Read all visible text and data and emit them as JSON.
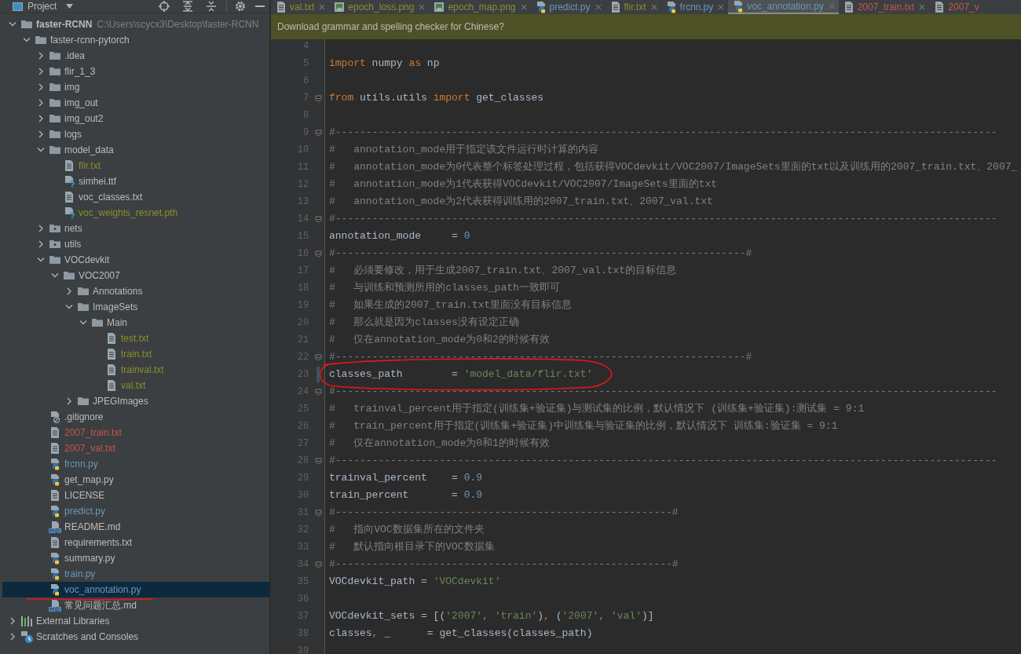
{
  "project_panel": {
    "title": "Project"
  },
  "tree": [
    {
      "name": "faster-RCNN",
      "kind": "folder",
      "path": "C:\\Users\\scycx3\\Desktop\\faster-RCNN",
      "color": "#bbbbbb",
      "expanded": true,
      "selected": false,
      "children": [
        {
          "name": "faster-rcnn-pytorch",
          "kind": "folder",
          "color": "#bbbbbb",
          "expanded": true,
          "selected": false,
          "children": [
            {
              "name": ".idea",
              "kind": "folder",
              "color": "#bbbbbb",
              "expanded": false,
              "selected": false
            },
            {
              "name": "flir_1_3",
              "kind": "folder",
              "color": "#bbbbbb",
              "expanded": false,
              "selected": false
            },
            {
              "name": "img",
              "kind": "folder",
              "color": "#bbbbbb",
              "expanded": false,
              "selected": false
            },
            {
              "name": "img_out",
              "kind": "folder",
              "color": "#bbbbbb",
              "expanded": false,
              "selected": false
            },
            {
              "name": "img_out2",
              "kind": "folder",
              "color": "#bbbbbb",
              "expanded": false,
              "selected": false
            },
            {
              "name": "logs",
              "kind": "folder",
              "color": "#bbbbbb",
              "expanded": false,
              "selected": false
            },
            {
              "name": "model_data",
              "kind": "folder",
              "color": "#bbbbbb",
              "expanded": true,
              "selected": false,
              "children": [
                {
                  "name": "flir.txt",
                  "kind": "txt",
                  "color": "#8a8f2a",
                  "selected": false
                },
                {
                  "name": "simhei.ttf",
                  "kind": "unknown",
                  "color": "#bbbbbb",
                  "selected": false
                },
                {
                  "name": "voc_classes.txt",
                  "kind": "txt",
                  "color": "#bbbbbb",
                  "selected": false
                },
                {
                  "name": "voc_weights_resnet.pth",
                  "kind": "unknown",
                  "color": "#8a8f2a",
                  "selected": false
                }
              ]
            },
            {
              "name": "nets",
              "kind": "module",
              "color": "#bbbbbb",
              "expanded": false,
              "selected": false
            },
            {
              "name": "utils",
              "kind": "module",
              "color": "#bbbbbb",
              "expanded": false,
              "selected": false
            },
            {
              "name": "VOCdevkit",
              "kind": "folder",
              "color": "#bbbbbb",
              "expanded": true,
              "selected": false,
              "children": [
                {
                  "name": "VOC2007",
                  "kind": "folder",
                  "color": "#bbbbbb",
                  "expanded": true,
                  "selected": false,
                  "children": [
                    {
                      "name": "Annotations",
                      "kind": "folder",
                      "color": "#bbbbbb",
                      "expanded": false,
                      "selected": false
                    },
                    {
                      "name": "ImageSets",
                      "kind": "folder",
                      "color": "#bbbbbb",
                      "expanded": true,
                      "selected": false,
                      "children": [
                        {
                          "name": "Main",
                          "kind": "folder",
                          "color": "#bbbbbb",
                          "expanded": true,
                          "selected": false,
                          "children": [
                            {
                              "name": "test.txt",
                              "kind": "txt",
                              "color": "#8a8f2a",
                              "selected": false
                            },
                            {
                              "name": "train.txt",
                              "kind": "txt",
                              "color": "#8a8f2a",
                              "selected": false
                            },
                            {
                              "name": "trainval.txt",
                              "kind": "txt",
                              "color": "#8a8f2a",
                              "selected": false
                            },
                            {
                              "name": "val.txt",
                              "kind": "txt",
                              "color": "#8a8f2a",
                              "selected": false
                            }
                          ]
                        }
                      ]
                    },
                    {
                      "name": "JPEGImages",
                      "kind": "folder",
                      "color": "#bbbbbb",
                      "expanded": false,
                      "selected": false
                    }
                  ]
                }
              ]
            },
            {
              "name": ".gitignore",
              "kind": "gitignore",
              "color": "#bbbbbb",
              "selected": false
            },
            {
              "name": "2007_train.txt",
              "kind": "txt",
              "color": "#c75450",
              "selected": false
            },
            {
              "name": "2007_val.txt",
              "kind": "txt",
              "color": "#c75450",
              "selected": false
            },
            {
              "name": "frcnn.py",
              "kind": "python",
              "color": "#6897bb",
              "selected": false
            },
            {
              "name": "get_map.py",
              "kind": "python",
              "color": "#bbbbbb",
              "selected": false
            },
            {
              "name": "LICENSE",
              "kind": "txt",
              "color": "#bbbbbb",
              "selected": false
            },
            {
              "name": "predict.py",
              "kind": "python",
              "color": "#6897bb",
              "selected": false
            },
            {
              "name": "README.md",
              "kind": "md",
              "color": "#bbbbbb",
              "selected": false
            },
            {
              "name": "requirements.txt",
              "kind": "txt",
              "color": "#bbbbbb",
              "selected": false
            },
            {
              "name": "summary.py",
              "kind": "python",
              "color": "#bbbbbb",
              "selected": false
            },
            {
              "name": "train.py",
              "kind": "python",
              "color": "#6897bb",
              "selected": false
            },
            {
              "name": "voc_annotation.py",
              "kind": "python",
              "color": "#6897bb",
              "selected": true
            },
            {
              "name": "常见问题汇总.md",
              "kind": "md",
              "color": "#bbbbbb",
              "selected": false
            }
          ]
        }
      ]
    },
    {
      "name": "External Libraries",
      "kind": "libraries",
      "color": "#bbbbbb",
      "expanded": false,
      "selected": false
    },
    {
      "name": "Scratches and Consoles",
      "kind": "scratches",
      "color": "#bbbbbb",
      "expanded": false,
      "selected": false
    }
  ],
  "tabs": [
    {
      "label": "val.txt",
      "kind": "txt",
      "color": "#8a8f2a",
      "selected": false
    },
    {
      "label": "epoch_loss.png",
      "kind": "image",
      "color": "#8a8f2a",
      "selected": false
    },
    {
      "label": "epoch_map.png",
      "kind": "image",
      "color": "#8a8f2a",
      "selected": false
    },
    {
      "label": "predict.py",
      "kind": "python",
      "color": "#6897bb",
      "selected": false
    },
    {
      "label": "flir.txt",
      "kind": "txt",
      "color": "#8a8f2a",
      "selected": false
    },
    {
      "label": "frcnn.py",
      "kind": "python",
      "color": "#6897bb",
      "selected": false
    },
    {
      "label": "voc_annotation.py",
      "kind": "python",
      "color": "#6897bb",
      "selected": true
    },
    {
      "label": "2007_train.txt",
      "kind": "txt",
      "color": "#c75450",
      "selected": false
    },
    {
      "label": "2007_v",
      "kind": "txt",
      "color": "#c75450",
      "selected": false
    }
  ],
  "notification": "Download grammar and spelling checker for Chinese?",
  "code_lines": [
    {
      "number": "4",
      "fold": false,
      "current": false
    },
    {
      "number": "5",
      "fold": false,
      "current": false,
      "tokens": [
        {
          "kind": "keyword",
          "text": "import "
        },
        {
          "kind": "plain",
          "text": "numpy "
        },
        {
          "kind": "keyword",
          "text": "as "
        },
        {
          "kind": "plain",
          "text": "np"
        }
      ]
    },
    {
      "number": "6",
      "fold": false,
      "current": false
    },
    {
      "number": "7",
      "fold": true,
      "current": false,
      "tokens": [
        {
          "kind": "keyword",
          "text": "from "
        },
        {
          "kind": "plain",
          "text": "utils.utils "
        },
        {
          "kind": "keyword",
          "text": "import "
        },
        {
          "kind": "plain",
          "text": "get_classes"
        }
      ]
    },
    {
      "number": "8",
      "fold": false,
      "current": false
    },
    {
      "number": "9",
      "fold": true,
      "current": false,
      "tokens": [
        {
          "kind": "comment",
          "text": "#------------------------------------------------------------------------------------------------------------"
        }
      ]
    },
    {
      "number": "10",
      "fold": false,
      "current": false,
      "tokens": [
        {
          "kind": "comment",
          "text": "#   annotation_mode用于指定该文件运行时计算的内容"
        }
      ]
    },
    {
      "number": "11",
      "fold": false,
      "current": false,
      "tokens": [
        {
          "kind": "comment",
          "text": "#   annotation_mode为0代表整个标签处理过程，包括获得VOCdevkit/VOC2007/ImageSets里面的txt以及训练用的2007_train.txt、2007_"
        }
      ]
    },
    {
      "number": "12",
      "fold": false,
      "current": false,
      "tokens": [
        {
          "kind": "comment",
          "text": "#   annotation_mode为1代表获得VOCdevkit/VOC2007/ImageSets里面的txt"
        }
      ]
    },
    {
      "number": "13",
      "fold": false,
      "current": false,
      "tokens": [
        {
          "kind": "comment",
          "text": "#   annotation_mode为2代表获得训练用的2007_train.txt、2007_val.txt"
        }
      ]
    },
    {
      "number": "14",
      "fold": true,
      "current": false,
      "tokens": [
        {
          "kind": "comment",
          "text": "#------------------------------------------------------------------------------------------------------------"
        }
      ]
    },
    {
      "number": "15",
      "fold": false,
      "current": false,
      "tokens": [
        {
          "kind": "plain",
          "text": "annotation_mode     = "
        },
        {
          "kind": "number",
          "text": "0"
        }
      ]
    },
    {
      "number": "16",
      "fold": true,
      "current": false,
      "tokens": [
        {
          "kind": "comment",
          "text": "#-------------------------------------------------------------------#"
        }
      ]
    },
    {
      "number": "17",
      "fold": false,
      "current": false,
      "tokens": [
        {
          "kind": "comment",
          "text": "#   必须要修改，用于生成2007_train.txt、2007_val.txt的目标信息"
        }
      ]
    },
    {
      "number": "18",
      "fold": false,
      "current": false,
      "tokens": [
        {
          "kind": "comment",
          "text": "#   与训练和预测所用的classes_path一致即可"
        }
      ]
    },
    {
      "number": "19",
      "fold": false,
      "current": false,
      "tokens": [
        {
          "kind": "comment",
          "text": "#   如果生成的2007_train.txt里面没有目标信息"
        }
      ]
    },
    {
      "number": "20",
      "fold": false,
      "current": false,
      "tokens": [
        {
          "kind": "comment",
          "text": "#   那么就是因为classes没有设定正确"
        }
      ]
    },
    {
      "number": "21",
      "fold": false,
      "current": false,
      "tokens": [
        {
          "kind": "comment",
          "text": "#   仅在annotation_mode为0和2的时候有效"
        }
      ]
    },
    {
      "number": "22",
      "fold": true,
      "current": false,
      "tokens": [
        {
          "kind": "comment",
          "text": "#-------------------------------------------------------------------#"
        }
      ]
    },
    {
      "number": "23",
      "fold": false,
      "current": true,
      "tokens": [
        {
          "kind": "plain",
          "text": "classes_path        = "
        },
        {
          "kind": "string",
          "text": "'model_data/flir.txt'"
        }
      ]
    },
    {
      "number": "24",
      "fold": true,
      "current": false,
      "tokens": [
        {
          "kind": "comment",
          "text": "#------------------------------------------------------------------------------------------------------------"
        }
      ]
    },
    {
      "number": "25",
      "fold": false,
      "current": false,
      "tokens": [
        {
          "kind": "comment",
          "text": "#   trainval_percent用于指定(训练集+验证集)与测试集的比例，默认情况下 (训练集+验证集):测试集 = 9:1"
        }
      ]
    },
    {
      "number": "26",
      "fold": false,
      "current": false,
      "tokens": [
        {
          "kind": "comment",
          "text": "#   train_percent用于指定(训练集+验证集)中训练集与验证集的比例，默认情况下 训练集:验证集 = 9:1"
        }
      ]
    },
    {
      "number": "27",
      "fold": false,
      "current": false,
      "tokens": [
        {
          "kind": "comment",
          "text": "#   仅在annotation_mode为0和1的时候有效"
        }
      ]
    },
    {
      "number": "28",
      "fold": true,
      "current": false,
      "tokens": [
        {
          "kind": "comment",
          "text": "#------------------------------------------------------------------------------------------------------------"
        }
      ]
    },
    {
      "number": "29",
      "fold": false,
      "current": false,
      "tokens": [
        {
          "kind": "plain",
          "text": "trainval_percent    = "
        },
        {
          "kind": "number",
          "text": "0.9"
        }
      ]
    },
    {
      "number": "30",
      "fold": false,
      "current": false,
      "tokens": [
        {
          "kind": "plain",
          "text": "train_percent       = "
        },
        {
          "kind": "number",
          "text": "0.9"
        }
      ]
    },
    {
      "number": "31",
      "fold": true,
      "current": false,
      "tokens": [
        {
          "kind": "comment",
          "text": "#-------------------------------------------------------#"
        }
      ]
    },
    {
      "number": "32",
      "fold": false,
      "current": false,
      "tokens": [
        {
          "kind": "comment",
          "text": "#   指向VOC数据集所在的文件夹"
        }
      ]
    },
    {
      "number": "33",
      "fold": false,
      "current": false,
      "tokens": [
        {
          "kind": "comment",
          "text": "#   默认指向根目录下的VOC数据集"
        }
      ]
    },
    {
      "number": "34",
      "fold": true,
      "current": false,
      "tokens": [
        {
          "kind": "comment",
          "text": "#-------------------------------------------------------#"
        }
      ]
    },
    {
      "number": "35",
      "fold": false,
      "current": false,
      "tokens": [
        {
          "kind": "plain",
          "text": "VOCdevkit_path = "
        },
        {
          "kind": "string",
          "text": "'VOCdevkit'"
        }
      ]
    },
    {
      "number": "36",
      "fold": false,
      "current": false
    },
    {
      "number": "37",
      "fold": false,
      "current": false,
      "tokens": [
        {
          "kind": "plain",
          "text": "VOCdevkit_sets = [("
        },
        {
          "kind": "string",
          "text": "'2007'"
        },
        {
          "kind": "keyword",
          "text": ", "
        },
        {
          "kind": "string",
          "text": "'train'"
        },
        {
          "kind": "plain",
          "text": ")"
        },
        {
          "kind": "keyword",
          "text": ", "
        },
        {
          "kind": "plain",
          "text": "("
        },
        {
          "kind": "string",
          "text": "'2007'"
        },
        {
          "kind": "keyword",
          "text": ", "
        },
        {
          "kind": "string",
          "text": "'val'"
        },
        {
          "kind": "plain",
          "text": ")]"
        }
      ]
    },
    {
      "number": "38",
      "fold": false,
      "current": false,
      "tokens": [
        {
          "kind": "plain",
          "text": "classes"
        },
        {
          "kind": "keyword",
          "text": ", "
        },
        {
          "kind": "plain",
          "text": "_      = get_classes(classes_path)"
        }
      ]
    },
    {
      "number": "39",
      "fold": false,
      "current": false
    }
  ]
}
